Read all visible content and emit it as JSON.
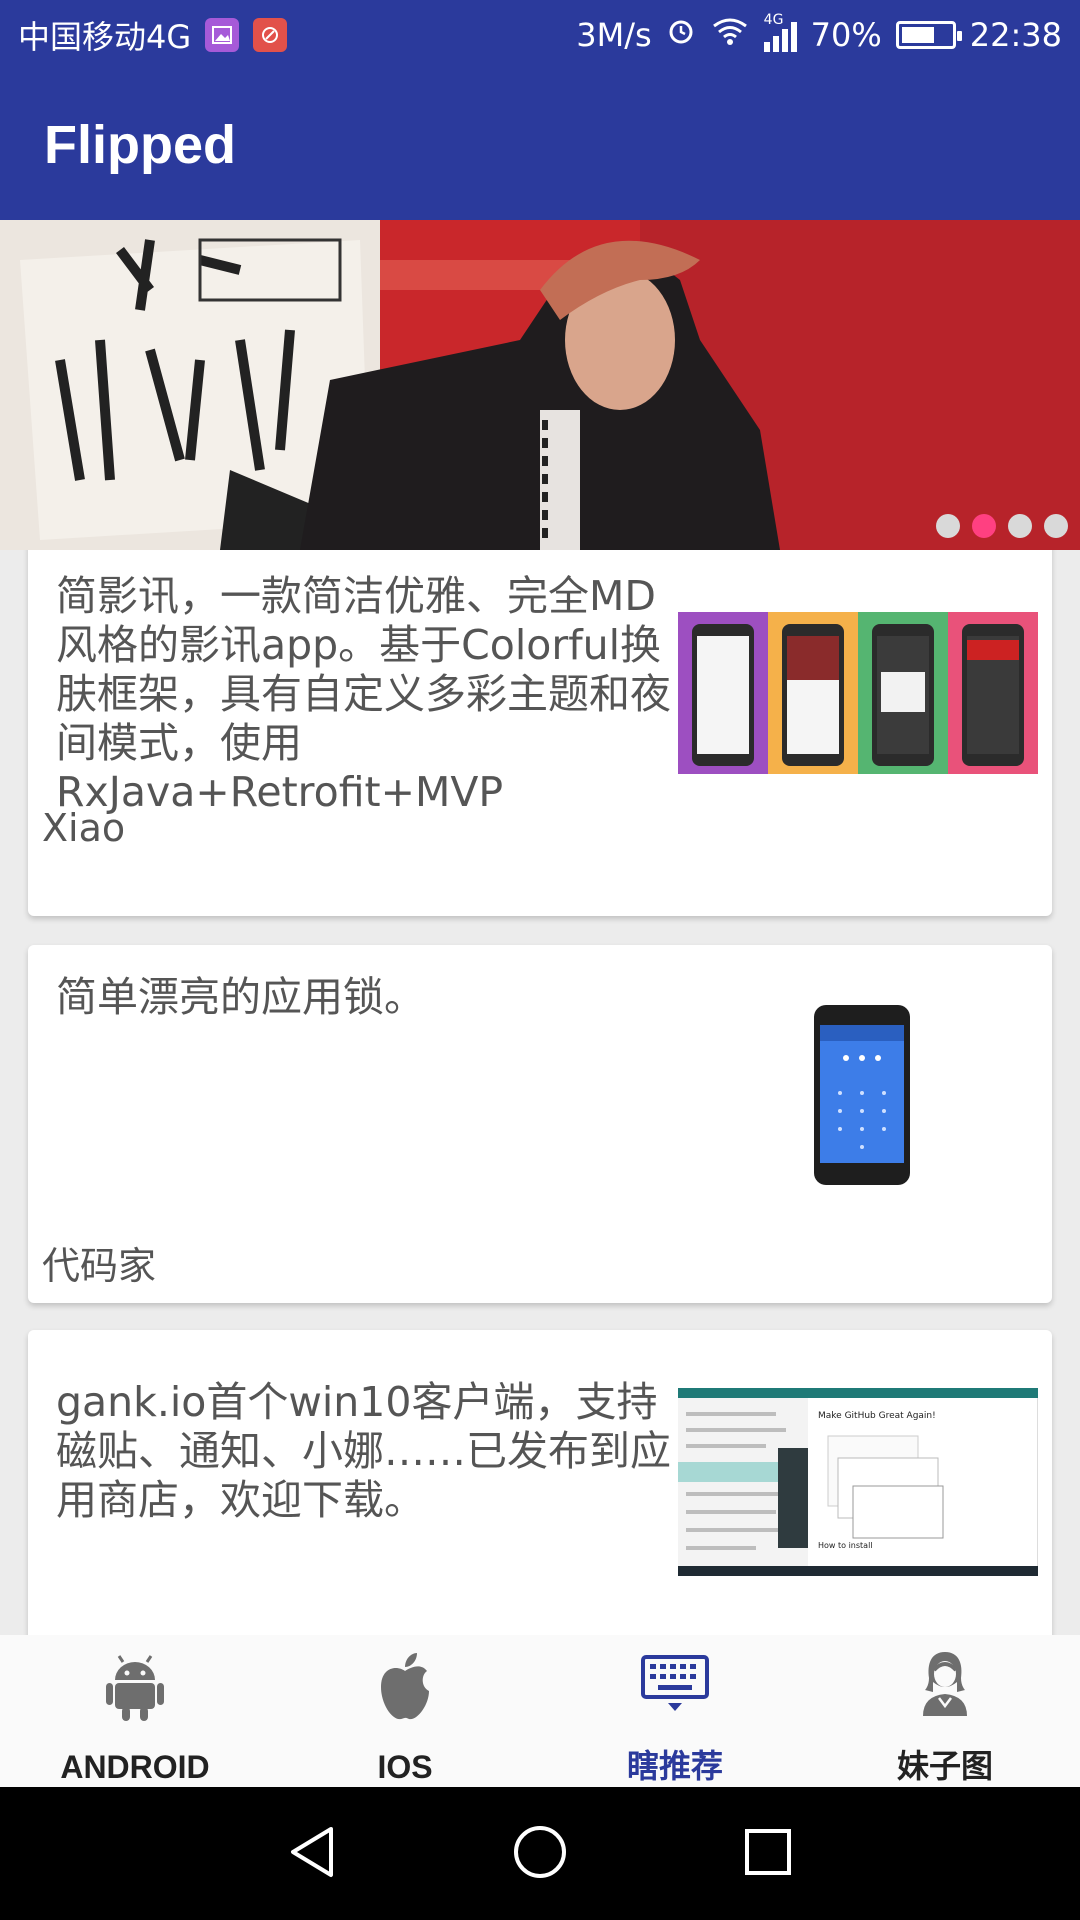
{
  "status_bar": {
    "carrier": "中国移动4G",
    "speed": "3M/s",
    "network": "4G",
    "battery_percent": "70%",
    "battery_level": 0.7,
    "time": "22:38"
  },
  "app_bar": {
    "title": "Flipped"
  },
  "banner": {
    "page_count": 4,
    "active_index": 1,
    "accent_color": "#ff4081"
  },
  "cards": [
    {
      "description": "简影讯，一款简洁优雅、完全MD风格的影讯app。基于Colorful换肤框架，具有自定义多彩主题和夜间模式，使用RxJava+Retrofit+MVP",
      "author": "Xiao"
    },
    {
      "description": "简单漂亮的应用锁。",
      "author": "代码家"
    },
    {
      "description": "gank.io首个win10客户端，支持磁贴、通知、小娜……已发布到应用商店，欢迎下载。",
      "author": "",
      "thumb_heading": "Make GitHub Great Again!",
      "thumb_footer": "How to install"
    }
  ],
  "bottom_nav": {
    "items": [
      {
        "label": "ANDROID",
        "icon": "android-icon"
      },
      {
        "label": "IOS",
        "icon": "apple-icon"
      },
      {
        "label": "瞎推荐",
        "icon": "keyboard-icon"
      },
      {
        "label": "妹子图",
        "icon": "girl-icon"
      }
    ],
    "active_index": 2,
    "active_color": "#2b3a9c"
  },
  "colors": {
    "primary": "#2b3a9c",
    "accent": "#ff4081"
  }
}
